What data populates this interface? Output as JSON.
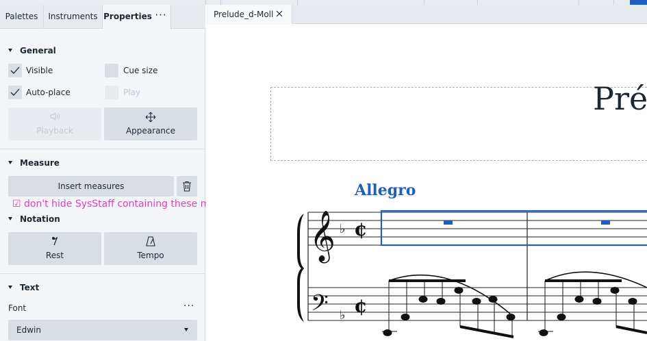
{
  "panel": {
    "tabs": [
      {
        "label": "Palettes"
      },
      {
        "label": "Instruments"
      },
      {
        "label": "Properties"
      }
    ],
    "more": "···",
    "general": {
      "title": "General",
      "visible": "Visible",
      "cue_size": "Cue size",
      "auto_place": "Auto-place",
      "play": "Play",
      "playback": "Playback",
      "appearance": "Appearance"
    },
    "measure": {
      "title": "Measure",
      "insert": "Insert measures"
    },
    "overlay_note": "☑ don't hide SysStaff containing these measures",
    "notation": {
      "title": "Notation",
      "rest": "Rest",
      "tempo": "Tempo"
    },
    "text": {
      "title": "Text",
      "font_label": "Font",
      "more": "···",
      "font_value": "Edwin"
    }
  },
  "document": {
    "tab_name": "Prelude_d-Moll",
    "title_text": "Pré",
    "tempo_marking": "Allegro"
  },
  "colors": {
    "accent": "#1f5fbf",
    "overlay": "#e040c8",
    "panel_bg": "#f3f5f8",
    "button_bg": "#d9dee5"
  }
}
